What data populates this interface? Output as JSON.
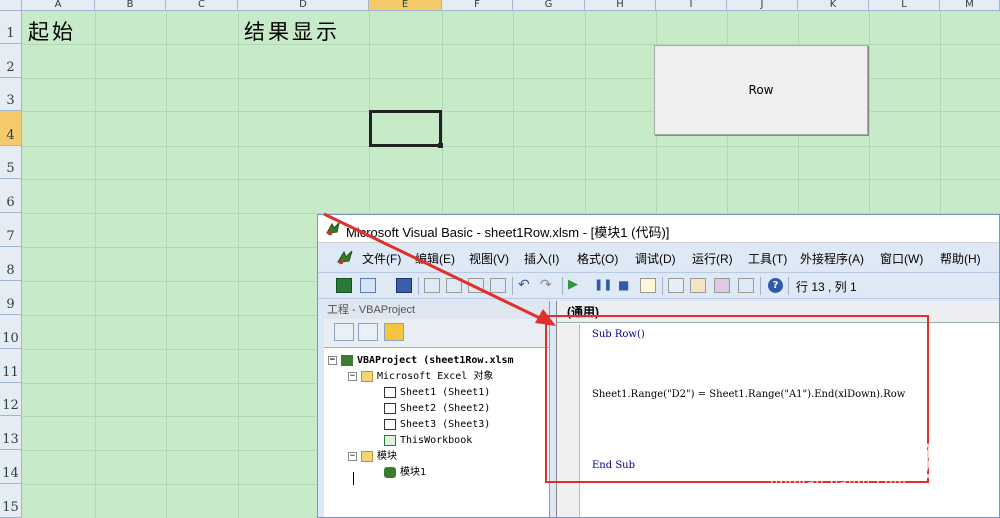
{
  "sheet": {
    "columns": [
      "A",
      "B",
      "C",
      "D",
      "E",
      "F",
      "G",
      "H",
      "I",
      "J",
      "K",
      "L",
      "M"
    ],
    "rows": [
      "1",
      "2",
      "3",
      "4",
      "5",
      "6",
      "7",
      "8",
      "9",
      "10",
      "11",
      "12",
      "13",
      "14",
      "15"
    ],
    "selected_column": "E",
    "selected_row": "4",
    "cell_a1": "起始",
    "cell_d1": "结果显示",
    "button_label": "Row"
  },
  "vbe": {
    "title": "Microsoft Visual Basic - sheet1Row.xlsm - [模块1 (代码)]",
    "menu": [
      "文件(F)",
      "编辑(E)",
      "视图(V)",
      "插入(I)",
      "格式(O)",
      "调试(D)",
      "运行(R)",
      "工具(T)",
      "外接程序(A)",
      "窗口(W)",
      "帮助(H)"
    ],
    "cursor_position": "行 13 , 列 1",
    "project_pane_title": "工程 - VBAProject",
    "tree": {
      "project": "VBAProject (sheet1Row.xlsm",
      "excel_objects": "Microsoft Excel 对象",
      "sheet1": "Sheet1 (Sheet1)",
      "sheet2": "Sheet2 (Sheet2)",
      "sheet3": "Sheet3 (Sheet3)",
      "thisworkbook": "ThisWorkbook",
      "modules": "模块",
      "module1": "模块1"
    },
    "code_object_combo": "(通用)",
    "code": {
      "line1": "Sub Row()",
      "line2": "Sheet1.Range(\"D2\") = Sheet1.Range(\"A1\").End(xlDown).Row",
      "line3": "End Sub"
    }
  },
  "watermark": {
    "logo": "Bai❀经验",
    "url": "jingyan.baidu.com"
  },
  "colors": {
    "sheet_bg": "#c7ebc9",
    "selected_header": "#f6c96b",
    "annotation_red": "#e0302a"
  }
}
